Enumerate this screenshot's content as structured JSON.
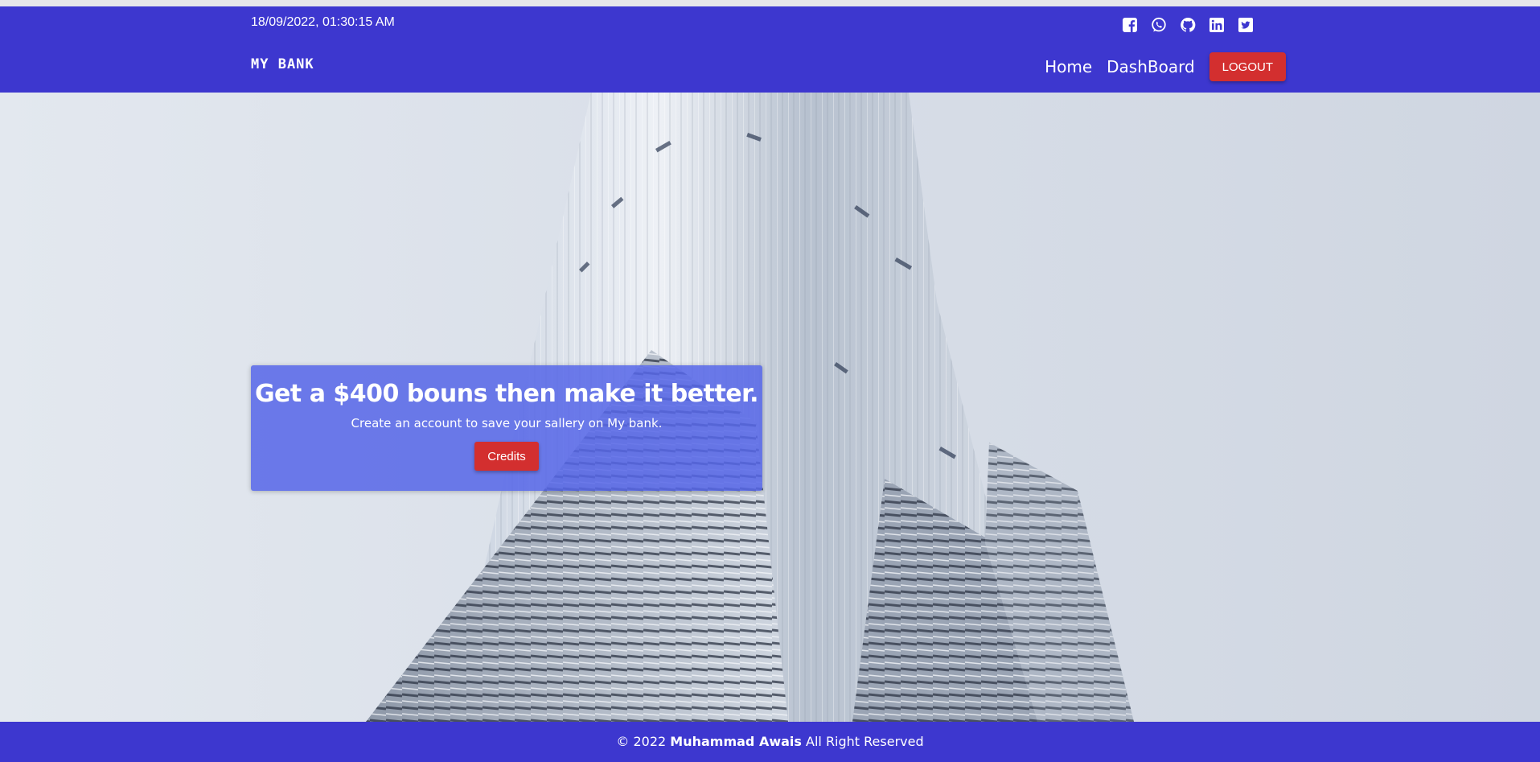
{
  "header": {
    "datetime": "18/09/2022, 01:30:15 AM",
    "brand": "MY BANK",
    "social_icons": [
      "facebook-icon",
      "whatsapp-icon",
      "github-icon",
      "linkedin-icon",
      "twitter-icon"
    ],
    "nav": {
      "home_label": "Home",
      "dashboard_label": "DashBoard",
      "logout_label": "LOGOUT"
    },
    "colors": {
      "primary": "#3d37cf",
      "danger": "#d32f2f"
    }
  },
  "hero": {
    "headline": "Get a $400 bouns then make it better.",
    "subtext": "Create an account to save your sallery on My bank.",
    "credits_label": "Credits",
    "background": "skyscraper-photo"
  },
  "footer": {
    "copyright_prefix": "© 2022",
    "author": "Muhammad Awais",
    "suffix": "All Right Reserved"
  }
}
